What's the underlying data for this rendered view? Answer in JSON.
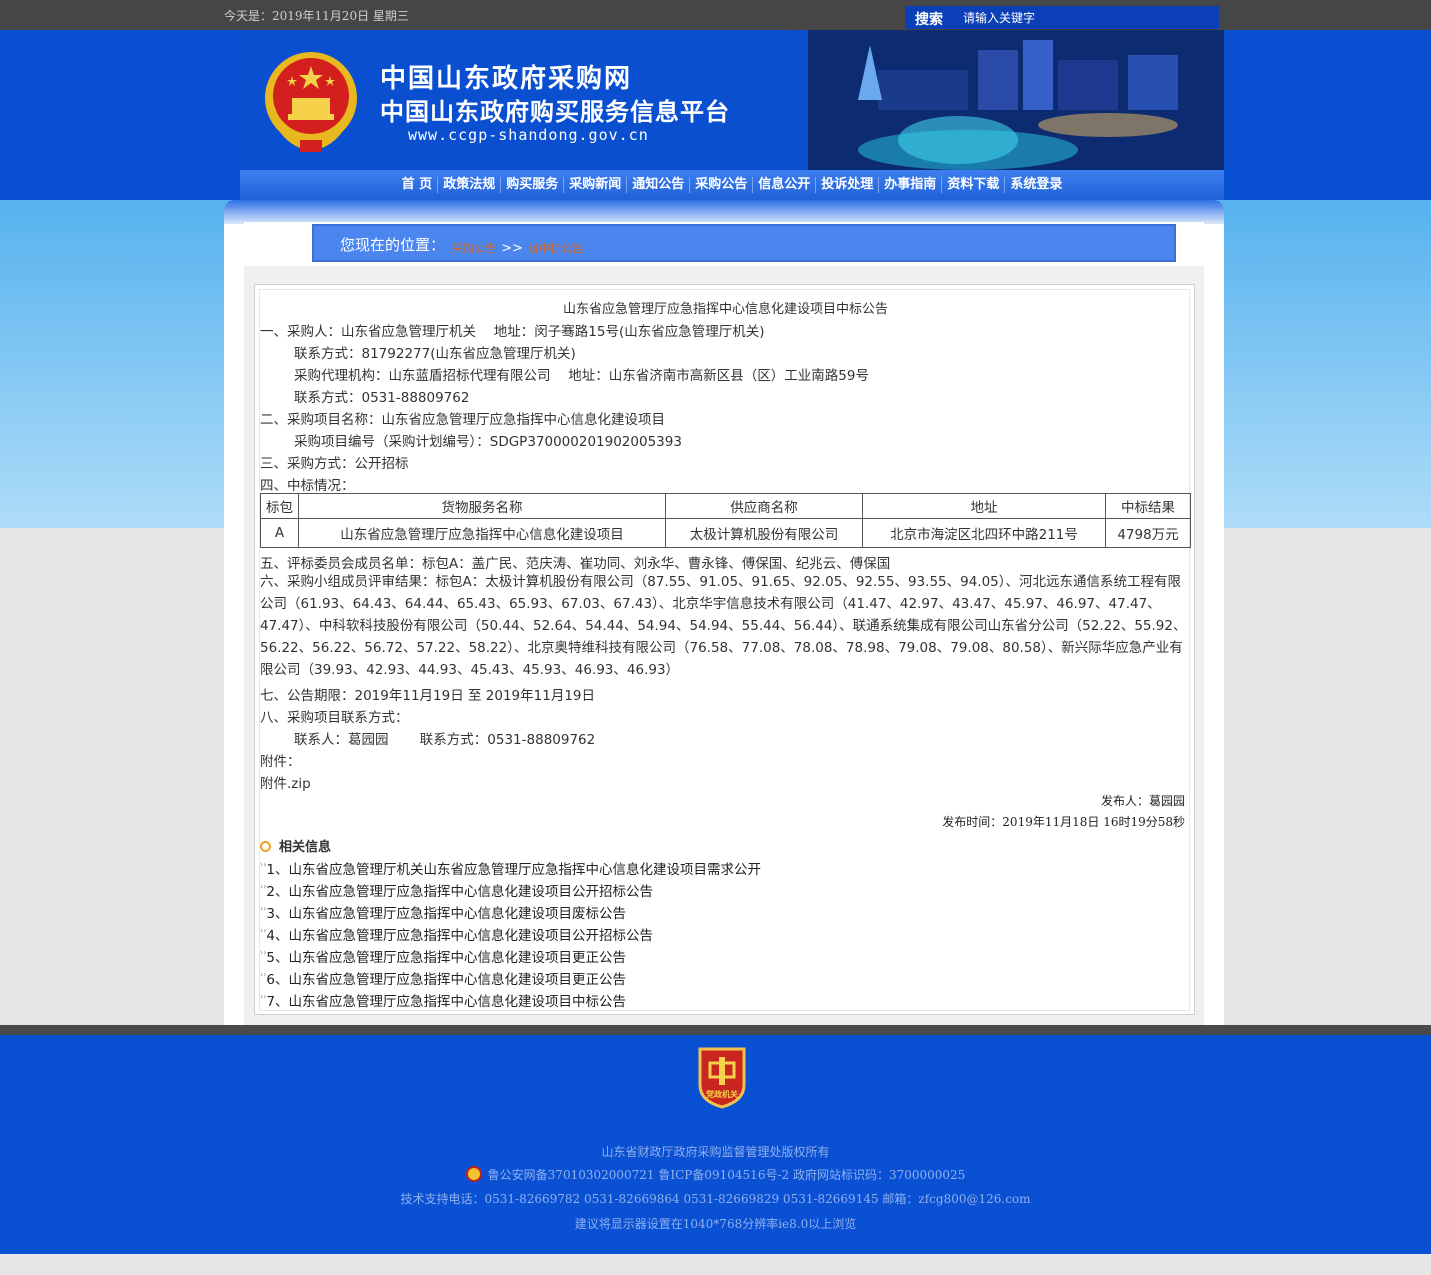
{
  "topbar": {
    "date": "今天是：2019年11月20日 星期三"
  },
  "search": {
    "label": "搜索",
    "placeholder": "请输入关键字"
  },
  "site": {
    "title": "中国山东政府采购网",
    "subtitle": "中国山东政府购买服务信息平台",
    "url": "www.ccgp-shandong.gov.cn"
  },
  "nav": [
    "首 页",
    "政策法规",
    "购买服务",
    "采购新闻",
    "通知公告",
    "采购公告",
    "信息公开",
    "投诉处理",
    "办事指南",
    "资料下载",
    "系统登录"
  ],
  "breadcrumb": {
    "label": "您现在的位置：",
    "link1": "采购公告",
    "sep": ">>",
    "link2": "省中标公告"
  },
  "article": {
    "title": "山东省应急管理厅应急指挥中心信息化建设项目中标公告",
    "lines": [
      "一、采购人：山东省应急管理厅机关　 地址：闵子骞路15号(山东省应急管理厅机关)",
      "联系方式：81792277(山东省应急管理厅机关)",
      "采购代理机构：山东蓝盾招标代理有限公司　 地址：山东省济南市高新区县（区）工业南路59号",
      "联系方式：0531-88809762",
      "二、采购项目名称：山东省应急管理厅应急指挥中心信息化建设项目",
      "采购项目编号（采购计划编号）：SDGP370000201902005393",
      "三、采购方式：公开招标",
      "四、中标情况："
    ],
    "table": {
      "headers": [
        "标包",
        "货物服务名称",
        "供应商名称",
        "地址",
        "中标结果"
      ],
      "rows": [
        [
          "A",
          "山东省应急管理厅应急指挥中心信息化建设项目",
          "太极计算机股份有限公司",
          "北京市海淀区北四环中路211号",
          "4798万元"
        ]
      ]
    },
    "committee": "五、评标委员会成员名单：标包A：盖广民、范庆涛、崔功同、刘永华、曹永锋、傅保国、纪兆云、傅保国",
    "scores": "六、采购小组成员评审结果：标包A：太极计算机股份有限公司（87.55、91.05、91.65、92.05、92.55、93.55、94.05）、河北远东通信系统工程有限公司（61.93、64.43、64.44、65.43、65.93、67.03、67.43）、北京华宇信息技术有限公司（41.47、42.97、43.47、45.97、46.97、47.47、47.47）、中科软科技股份有限公司（50.44、52.64、54.44、54.94、54.94、55.44、56.44）、联通系统集成有限公司山东省分公司（52.22、55.92、56.22、56.22、56.72、57.22、58.22）、北京奥特维科技有限公司（76.58、77.08、78.08、78.98、79.08、79.08、80.58）、新兴际华应急产业有限公司（39.93、42.93、44.93、45.43、45.93、46.93、46.93）",
    "period": "七、公告期限：2019年11月19日 至 2019年11月19日",
    "contact_head": "八、采购项目联系方式：",
    "contact": "联系人：葛园园　　 联系方式：0531-88809762",
    "attach_label": "附件：",
    "attach_file": "附件.zip",
    "publisher": "发布人：葛园园",
    "publish_time": "发布时间：2019年11月18日 16时19分58秒"
  },
  "related": {
    "heading": "相关信息",
    "items": [
      "1、山东省应急管理厅机关山东省应急管理厅应急指挥中心信息化建设项目需求公开",
      "2、山东省应急管理厅应急指挥中心信息化建设项目公开招标公告",
      "3、山东省应急管理厅应急指挥中心信息化建设项目废标公告",
      "4、山东省应急管理厅应急指挥中心信息化建设项目公开招标公告",
      "5、山东省应急管理厅应急指挥中心信息化建设项目更正公告",
      "6、山东省应急管理厅应急指挥中心信息化建设项目更正公告",
      "7、山东省应急管理厅应急指挥中心信息化建设项目中标公告"
    ]
  },
  "footer": {
    "badge_text": "党政机关",
    "copyright": "山东省财政厅政府采购监督管理处版权所有",
    "record": "鲁公安网备37010302000721 鲁ICP备09104516号-2  政府网站标识码：3700000025",
    "support": "技术支持电话：0531-82669782 0531-82669864 0531-82669829 0531-82669145 邮箱：zfcg800@126.com",
    "advice": "建议将显示器设置在1040*768分辨率ie8.0以上浏览"
  }
}
